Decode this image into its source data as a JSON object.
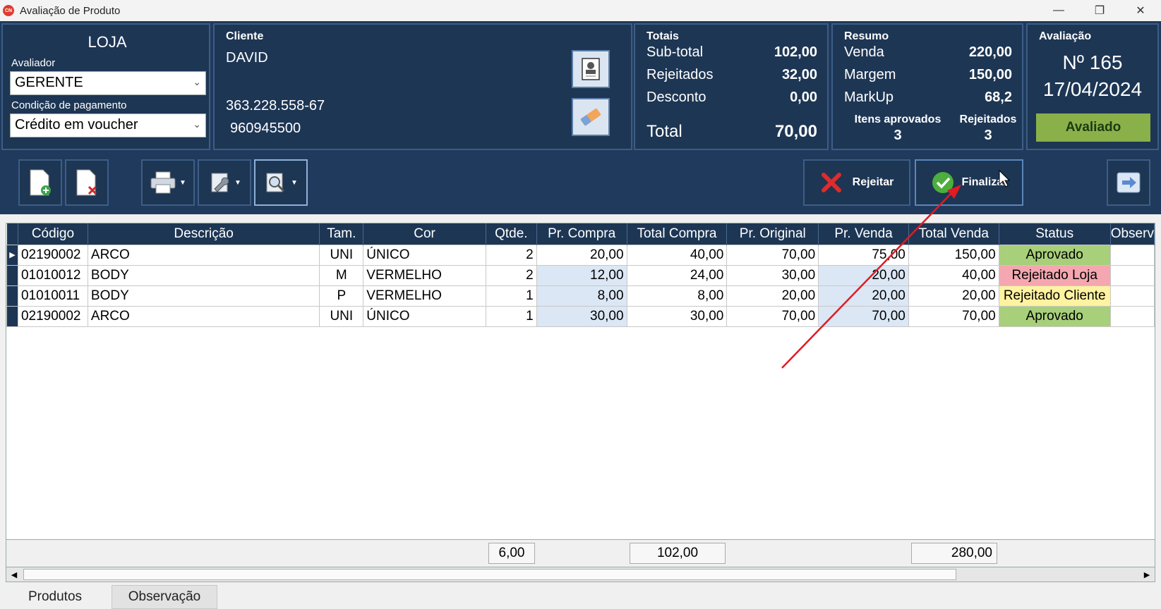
{
  "window": {
    "title": "Avaliação de Produto",
    "icon_text": "CN"
  },
  "loja": {
    "title": "LOJA",
    "avaliador_label": "Avaliador",
    "avaliador_value": "GERENTE",
    "pagamento_label": "Condição de pagamento",
    "pagamento_value": "Crédito em voucher"
  },
  "cliente": {
    "title": "Cliente",
    "name": "DAVID",
    "document": "363.228.558-67",
    "phone": "960945500"
  },
  "totais": {
    "title": "Totais",
    "subtotal_label": "Sub-total",
    "subtotal_value": "102,00",
    "rejeitados_label": "Rejeitados",
    "rejeitados_value": "32,00",
    "desconto_label": "Desconto",
    "desconto_value": "0,00",
    "total_label": "Total",
    "total_value": "70,00"
  },
  "resumo": {
    "title": "Resumo",
    "venda_label": "Venda",
    "venda_value": "220,00",
    "margem_label": "Margem",
    "margem_value": "150,00",
    "markup_label": "MarkUp",
    "markup_value": "68,2",
    "aprovados_label": "Itens aprovados",
    "aprovados_value": "3",
    "rejeitados_label": "Rejeitados",
    "rejeitados_value": "3"
  },
  "avaliacao": {
    "title": "Avaliação",
    "number": "Nº 165",
    "date": "17/04/2024",
    "status": "Avaliado"
  },
  "toolbar": {
    "rejeitar_label": "Rejeitar",
    "finalizar_label": "Finalizar"
  },
  "table": {
    "headers": [
      "Código",
      "Descrição",
      "Tam.",
      "Cor",
      "Qtde.",
      "Pr. Compra",
      "Total Compra",
      "Pr. Original",
      "Pr. Venda",
      "Total Venda",
      "Status",
      "Observ"
    ],
    "rows": [
      [
        "02190002",
        "ARCO",
        "UNI",
        "ÚNICO",
        "2",
        "20,00",
        "40,00",
        "70,00",
        "75,00",
        "150,00",
        "Aprovado",
        ""
      ],
      [
        "01010012",
        "BODY",
        "M",
        "VERMELHO",
        "2",
        "12,00",
        "24,00",
        "30,00",
        "20,00",
        "40,00",
        "Rejeitado Loja",
        ""
      ],
      [
        "01010011",
        "BODY",
        "P",
        "VERMELHO",
        "1",
        "8,00",
        "8,00",
        "20,00",
        "20,00",
        "20,00",
        "Rejeitado Cliente",
        ""
      ],
      [
        "02190002",
        "ARCO",
        "UNI",
        "ÚNICO",
        "1",
        "30,00",
        "30,00",
        "70,00",
        "70,00",
        "70,00",
        "Aprovado",
        ""
      ]
    ],
    "totals": {
      "qtde": "6,00",
      "total_compra": "102,00",
      "total_venda": "280,00"
    }
  },
  "tabs": [
    "Produtos",
    "Observação"
  ],
  "colors": {
    "header_bg": "#1f3a5c",
    "approved": "#a8cf7a",
    "rejected_store": "#f4a7b0",
    "rejected_client": "#fff2a0",
    "annotation_arrow": "#e01b24"
  }
}
